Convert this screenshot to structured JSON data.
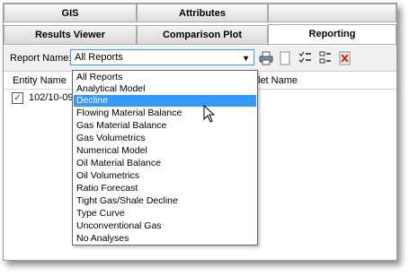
{
  "tabs_row1": [
    "GIS",
    "Attributes"
  ],
  "tabs_row2": [
    "Results Viewer",
    "Comparison Plot",
    "Reporting"
  ],
  "toolbar": {
    "report_name_label": "Report Name:",
    "selected_report": "All Reports"
  },
  "grid": {
    "col_entity": "Entity Name",
    "col_right_fragment": "let Name",
    "row_entity": "102/10-09",
    "row_checked": true
  },
  "dropdown": {
    "highlighted": "Decline",
    "options": [
      "All Reports",
      "Analytical Model",
      "Decline",
      "Flowing Material Balance",
      "Gas Material Balance",
      "Gas Volumetrics",
      "Numerical Model",
      "Oil Material Balance",
      "Oil Volumetrics",
      "Ratio Forecast",
      "Tight Gas/Shale Decline",
      "Type Curve",
      "Unconventional Gas",
      "No Analyses"
    ]
  },
  "icons": [
    "printer-icon",
    "blank-page-icon",
    "check-list-icon",
    "select-list-icon",
    "delete-report-icon"
  ],
  "colors": {
    "selection": "#3399ff",
    "delete_red": "#d9261c"
  }
}
